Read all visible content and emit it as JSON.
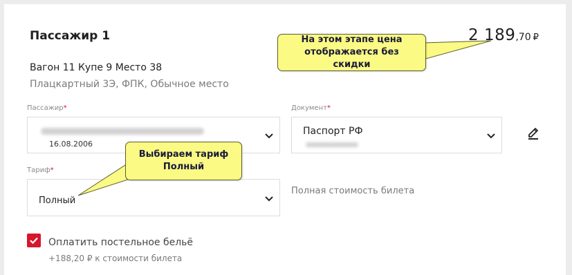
{
  "passenger": {
    "title": "Пассажир 1",
    "price": {
      "integer": "2 189",
      "fraction": ",70",
      "currency": "₽"
    },
    "seat_line": "Вагон 11 Купе 9 Место 38",
    "seat_details": "Плацкартный 3Э, ФПК, Обычное место"
  },
  "form": {
    "passenger_label": "Пассажир",
    "passenger_birthdate": "16.08.2006",
    "document_label": "Документ",
    "document_value": "Паспорт РФ",
    "tariff_label": "Тариф",
    "tariff_value": "Полный",
    "tariff_note": "Полная стоимость билета",
    "required_mark": "*"
  },
  "bedding": {
    "label": "Оплатить постельное бельё",
    "note": "+188,20 ₽ к стоимости билета",
    "checked": true
  },
  "callouts": {
    "price": "На этом этапе цена отображается без скидки",
    "tariff": "Выбираем тариф Полный"
  },
  "colors": {
    "accent": "#d6162d",
    "callout_fill": "#fafa84"
  },
  "icons": {
    "dropdown": "chevron-down-icon",
    "edit": "pencil-icon",
    "check": "check-icon"
  }
}
